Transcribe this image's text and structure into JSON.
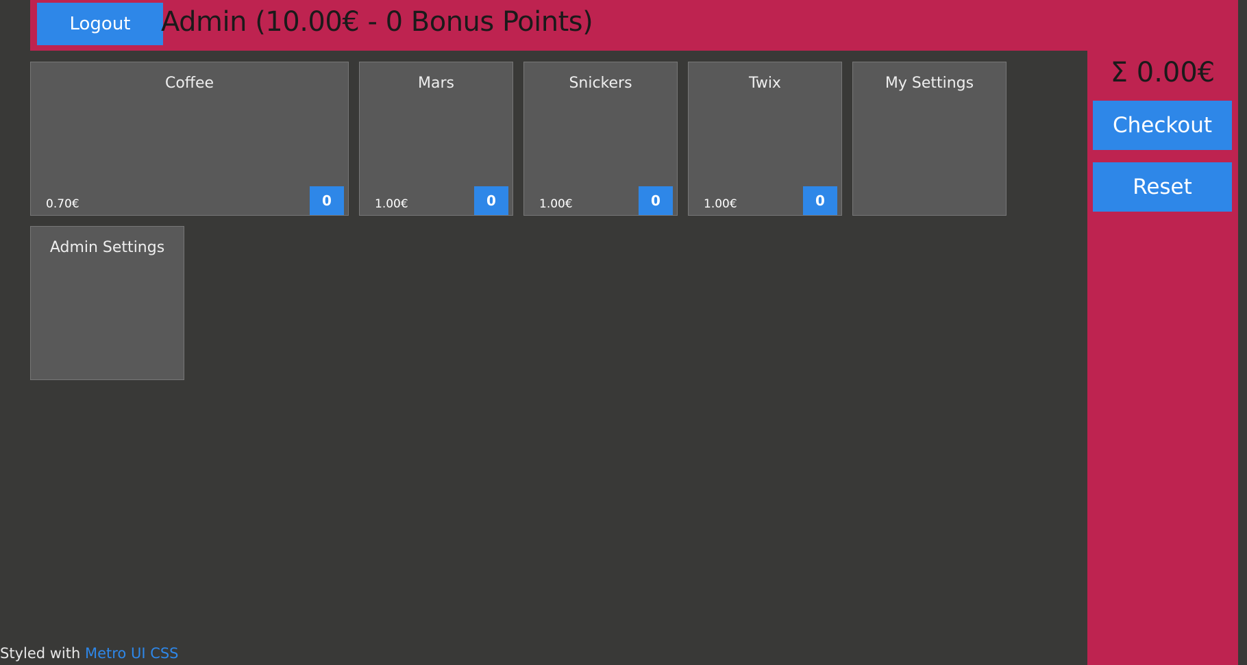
{
  "header": {
    "logout_label": "Logout",
    "user_title": "Admin (10.00€ - 0 Bonus Points)"
  },
  "sidebar": {
    "total": "Σ 0.00€",
    "checkout_label": "Checkout",
    "reset_label": "Reset"
  },
  "products": [
    {
      "name": "Coffee",
      "price": "0.70€",
      "count": "0"
    },
    {
      "name": "Mars",
      "price": "1.00€",
      "count": "0"
    },
    {
      "name": "Snickers",
      "price": "1.00€",
      "count": "0"
    },
    {
      "name": "Twix",
      "price": "1.00€",
      "count": "0"
    }
  ],
  "settings_tiles": {
    "my_settings": "My Settings",
    "admin_settings": "Admin Settings"
  },
  "footer": {
    "prefix": "Styled with ",
    "link_label": "Metro UI CSS"
  },
  "colors": {
    "accent": "#be2350",
    "button": "#2e87e8",
    "background": "#393937",
    "tile": "#595959"
  }
}
